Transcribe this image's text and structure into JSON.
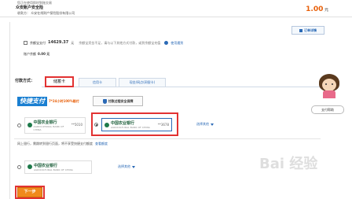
{
  "header": {
    "line1": "您正在使用即时到账交易",
    "line2": "众安账户安全险",
    "payee": "收款方： 众安在线财产保险股份有限公司",
    "amount": "1.00",
    "amount_unit": "元",
    "order_details": "订单详情"
  },
  "balance": {
    "checkbox_label": "余额宝支付",
    "balance_amount": "14629.37",
    "unit": "元",
    "note": "余额宝资金不足，请与以下其他方式付款，或到余额宝充值",
    "help_link": "使用遇到",
    "account_balance_label": "账户余额",
    "account_balance_value": "0.00 元"
  },
  "tabs": {
    "label": "付款方式：",
    "items": [
      "储蓄卡",
      "信用卡",
      "现金/网点(网银卡)"
    ]
  },
  "quickpay": {
    "badge": "快捷支付",
    "slogan": "7*24小时100%赔付",
    "secure_badge": "付款过程安全保障"
  },
  "cards": [
    {
      "bank": "中国农业银行",
      "sub": "AGRICULTURAL BANK OF CHINA",
      "tail": "**5010",
      "selected": false
    },
    {
      "bank": "中国农业银行",
      "sub": "AGRICULTURAL BANK OF CHINA",
      "tail": "**3678",
      "selected": true
    }
  ],
  "choose_other": "选择其他",
  "netbank": {
    "text": "网上银行，需跳转到银行页面，将不享受快捷支付额度",
    "link": "查看额度",
    "bank": "中国农业银行",
    "sub": "AGRICULTURAL BANK OF CHINA"
  },
  "next_button": "下一步",
  "mascot_bubble": "支付帮助",
  "watermark": "Bai 经验"
}
